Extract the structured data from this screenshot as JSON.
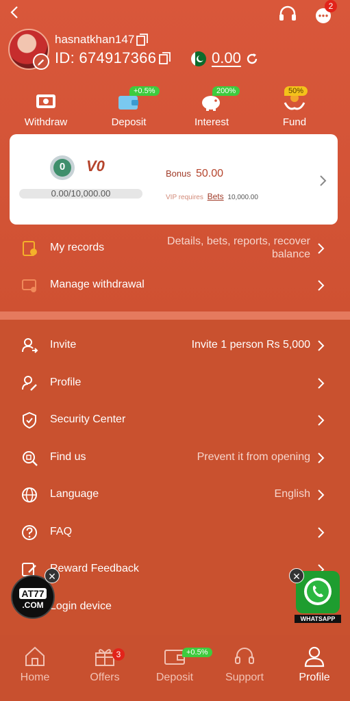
{
  "header": {
    "support_badge": "",
    "chat_badge": "2"
  },
  "user": {
    "username": "hasnatkhan147",
    "id_label": "ID: 674917366",
    "balance": "0.00"
  },
  "quick_actions": [
    {
      "label": "Withdraw",
      "badge": "",
      "icon": "withdraw-icon"
    },
    {
      "label": "Deposit",
      "badge": "+0.5%",
      "icon": "wallet-icon"
    },
    {
      "label": "Interest",
      "badge": "200%",
      "icon": "piggy-bank-icon"
    },
    {
      "label": "Fund",
      "badge": "50%",
      "icon": "fund-hands-icon"
    }
  ],
  "vip": {
    "level_badge": "0",
    "level": "V0",
    "progress_text": "0.00/10,000.00",
    "progress": 0.0,
    "bonus_label": "Bonus",
    "bonus_value": "50.00",
    "requires_prefix": "VIP requires",
    "requires_link": "Bets",
    "requires_amount": "10,000.00"
  },
  "menu_top": [
    {
      "label": "My records",
      "value_line1": "Details, bets, reports, recover",
      "value_line2": "balance"
    },
    {
      "label": "Manage withdrawal",
      "value_line1": "",
      "value_line2": ""
    }
  ],
  "menu": [
    {
      "label": "Invite",
      "value": "Invite 1 person Rs 5,000",
      "icon": "invite-user-icon"
    },
    {
      "label": "Profile",
      "value": "",
      "icon": "profile-edit-icon"
    },
    {
      "label": "Security Center",
      "value": "",
      "icon": "shield-icon"
    },
    {
      "label": "Find us",
      "value": "Prevent it from opening",
      "icon": "find-us-icon"
    },
    {
      "label": "Language",
      "value": "English",
      "icon": "globe-icon"
    },
    {
      "label": "FAQ",
      "value": "",
      "icon": "question-icon"
    },
    {
      "label": "Reward Feedback",
      "value": "",
      "icon": "feedback-icon"
    },
    {
      "label": "Login device",
      "value": "",
      "icon": "device-icon"
    }
  ],
  "floating": {
    "left_logo_line1": "AT77",
    "left_logo_line2": ".COM",
    "whatsapp_label": "WHATSAPP"
  },
  "tabs": [
    {
      "label": "Home",
      "badge": ""
    },
    {
      "label": "Offers",
      "badge": "3"
    },
    {
      "label": "Deposit",
      "badge": "+0.5%"
    },
    {
      "label": "Support",
      "badge": ""
    },
    {
      "label": "Profile",
      "badge": ""
    }
  ],
  "colors": {
    "primary_bg": "#c9512f",
    "accent_badge": "#3ecb3e",
    "alert_badge": "#e2231a",
    "vip_text": "#b5442c"
  }
}
